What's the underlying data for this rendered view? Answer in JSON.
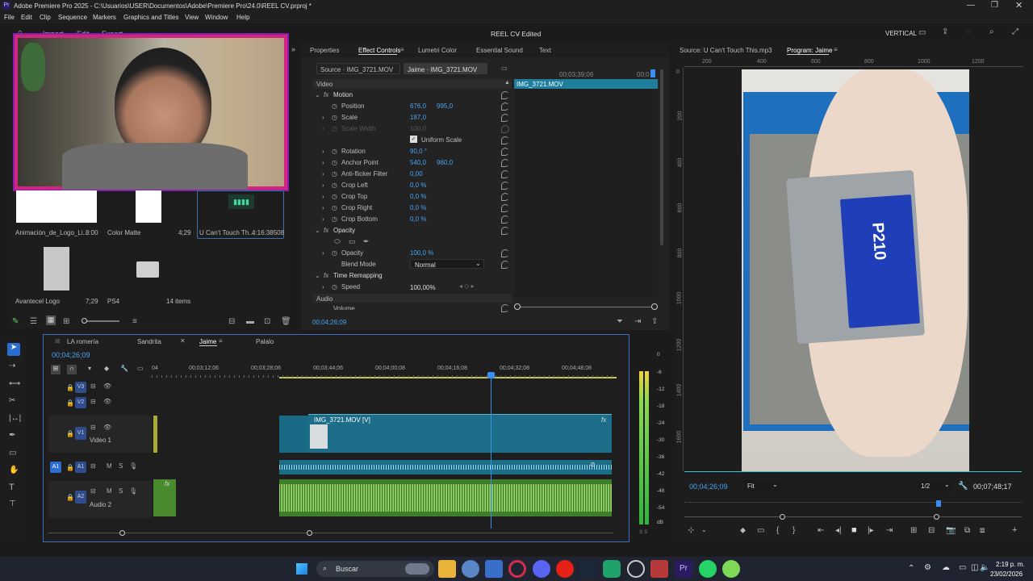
{
  "titlebar": {
    "title": "Adobe Premiere Pro 2025 - C:\\Usuarios\\USER\\Documentos\\Adobe\\Premiere Pro\\24.0\\REEL CV.prproj *"
  },
  "menu": [
    "File",
    "Edit",
    "Clip",
    "Sequence",
    "Markers",
    "Graphics and Titles",
    "View",
    "Window",
    "Help"
  ],
  "header": {
    "tabs": [
      "Import",
      "Edit",
      "Export"
    ],
    "project_title": "REEL CV",
    "status": "- Edited",
    "workspace": "VERTICAL"
  },
  "project": {
    "items": [
      {
        "name": "Animación_de_Logo_Li...",
        "duration": "8:00"
      },
      {
        "name": "Color Matte",
        "duration": "4;29"
      },
      {
        "name": "U Can't Touch Th...",
        "duration": "4:16:38508"
      },
      {
        "name": "Avantecel Logo",
        "duration": "7;29"
      },
      {
        "name": "PS4",
        "duration": ""
      }
    ],
    "count": "14 items"
  },
  "effect_controls": {
    "tabs": [
      "Properties",
      "Effect Controls",
      "Lumetri Color",
      "Essential Sound",
      "Text"
    ],
    "source": "Source · IMG_3721.MOV",
    "sequence": "Jaime · IMG_3721.MOV",
    "ruler_time": "00;03;39;06",
    "ruler_end": "00;0",
    "clip_label": "IMG_3721.MOV",
    "video_label": "Video",
    "audio_label": "Audio",
    "motion": "Motion",
    "props": [
      {
        "name": "Position",
        "v1": "676,0",
        "v2": "995,0"
      },
      {
        "name": "Scale",
        "v1": "187,0",
        "v2": ""
      },
      {
        "name": "Scale Width",
        "v1": "100,0",
        "v2": ""
      },
      {
        "name": "Uniform Scale",
        "v1": "",
        "v2": ""
      },
      {
        "name": "Rotation",
        "v1": "90,0 °",
        "v2": ""
      },
      {
        "name": "Anchor Point",
        "v1": "540,0",
        "v2": "960,0"
      },
      {
        "name": "Anti-flicker Filter",
        "v1": "0,00",
        "v2": ""
      },
      {
        "name": "Crop Left",
        "v1": "0,0 %",
        "v2": ""
      },
      {
        "name": "Crop Top",
        "v1": "0,0 %",
        "v2": ""
      },
      {
        "name": "Crop Right",
        "v1": "0,0 %",
        "v2": ""
      },
      {
        "name": "Crop Bottom",
        "v1": "0,0 %",
        "v2": ""
      }
    ],
    "opacity_group": "Opacity",
    "opacity_label": "Opacity",
    "opacity_value": "100,0 %",
    "blend_label": "Blend Mode",
    "blend_value": "Normal",
    "time_remap": "Time Remapping",
    "speed_label": "Speed",
    "speed_value": "100,00%",
    "volume": "Volume",
    "current_time": "00;04;26;09"
  },
  "source_monitor": {
    "title": "Source: U Can't Touch This.mp3",
    "program_title": "Program: Jaime",
    "ruler": [
      "200",
      "400",
      "600",
      "800",
      "1000",
      "1200"
    ],
    "v_ruler": [
      "0",
      "200",
      "400",
      "600",
      "800",
      "1000",
      "1200",
      "1400",
      "1600",
      "1800"
    ]
  },
  "program": {
    "timecode": "00;04;26;09",
    "fit": "Fit",
    "resolution": "1/2",
    "duration": "00;07;48;17"
  },
  "timeline": {
    "tabs": [
      "LA romería",
      "Sandrita",
      "Jaime",
      "Palalo"
    ],
    "active_tab": "Jaime",
    "timecode": "00;04;26;09",
    "ruler": [
      "04",
      "00;03;12;06",
      "00;03;28;06",
      "00;03;44;06",
      "00;04;00;08",
      "00;04;16;08",
      "00;04;32;08",
      "00;04;48;08"
    ],
    "tracks": {
      "v3": "V3",
      "v2": "V2",
      "v1": "V1",
      "v1_name": "Video 1",
      "a1": "A1",
      "a2": "A2",
      "a2_name": "Audio 2"
    },
    "clip_video": "IMG_3721.MOV [V]"
  },
  "meter": {
    "labels": [
      "0",
      "-6",
      "-12",
      "-18",
      "-24",
      "-30",
      "-36",
      "-42",
      "-48",
      "-54",
      "dB"
    ],
    "solo": "S S"
  },
  "taskbar": {
    "search": "Buscar",
    "time": "2:19 p. m.",
    "date": "23/02/2026"
  }
}
